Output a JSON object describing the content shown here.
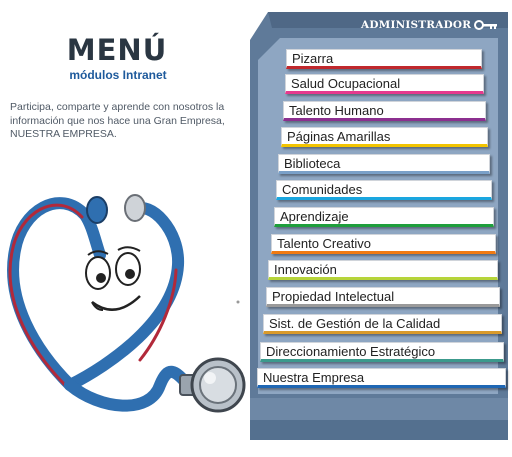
{
  "header": {
    "title": "MENÚ",
    "subtitle": "módulos Intranet"
  },
  "intro_text": "Participa, comparte y aprende con nosotros la información que nos hace una Gran Empresa, NUESTRA EMPRESA.",
  "admin": {
    "label": "ADMINISTRADOR",
    "icon": "key-icon"
  },
  "menu": {
    "items": [
      {
        "label": "Pizarra",
        "accent": "#c0282d"
      },
      {
        "label": "Salud Ocupacional",
        "accent": "#e63a8e"
      },
      {
        "label": "Talento Humano",
        "accent": "#8c2f8f"
      },
      {
        "label": "Páginas Amarillas",
        "accent": "#f2c400"
      },
      {
        "label": "Biblioteca",
        "accent": "#7aa0c8"
      },
      {
        "label": "Comunidades",
        "accent": "#1aa6df"
      },
      {
        "label": "Aprendizaje",
        "accent": "#1e9e3c"
      },
      {
        "label": "Talento Creativo",
        "accent": "#f07a12"
      },
      {
        "label": "Innovación",
        "accent": "#b6d43a"
      },
      {
        "label": "Propiedad Intelectual",
        "accent": "#9a9a9a"
      },
      {
        "label": "Sist. de Gestión de la Calidad",
        "accent": "#d99a2b"
      },
      {
        "label": "Direccionamiento Estratégico",
        "accent": "#3c9a8c"
      },
      {
        "label": "Nuestra Empresa",
        "accent": "#1f67b4"
      }
    ]
  },
  "colors": {
    "panel_frame": "#5f7a99",
    "panel_inner": "#8ea6c2",
    "title": "#2a3642",
    "subtitle": "#1e5a9c",
    "stethoscope": "#2f6fb0"
  },
  "mascot": {
    "icon": "stethoscope-mascot-icon"
  }
}
